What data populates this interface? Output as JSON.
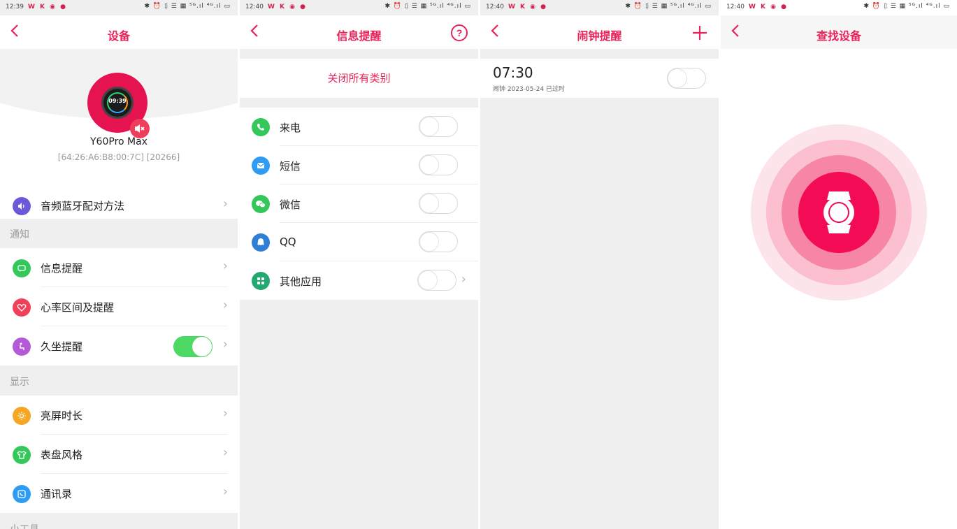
{
  "panels": {
    "device": {
      "status": {
        "time": "12:39",
        "apps": "W K ◉ ●",
        "sys": "✱ ⏰ ▯ ☰ ▦ ⁵ᴳ.ıl ⁴ᴳ.ıl ▭"
      },
      "title": "设备",
      "device_name": "Y60Pro Max",
      "device_meta": "[64:26:A6:B8:00:7C]   [20266]",
      "watch_time": "09:39",
      "rows_top": [
        {
          "label": "音频蓝牙配对方法",
          "icon": "speaker-icon",
          "color": "#6a5ad8"
        }
      ],
      "section_notify": "通知",
      "rows_notify": [
        {
          "label": "信息提醒",
          "icon": "message-icon",
          "color": "#34c759"
        },
        {
          "label": "心率区间及提醒",
          "icon": "heart-icon",
          "color": "#f0405a"
        },
        {
          "label": "久坐提醒",
          "icon": "sedentary-icon",
          "color": "#b45ad8",
          "toggle": true
        }
      ],
      "section_display": "显示",
      "rows_display": [
        {
          "label": "亮屏时长",
          "icon": "brightness-icon",
          "color": "#f5a623"
        },
        {
          "label": "表盘风格",
          "icon": "shirt-icon",
          "color": "#34c759"
        },
        {
          "label": "通讯录",
          "icon": "contacts-icon",
          "color": "#2e9cf5"
        }
      ],
      "section_tools": "小工具"
    },
    "messages": {
      "status": {
        "time": "12:40",
        "apps": "W K ◉ ●",
        "sys": "✱ ⏰ ▯ ☰ ▦ ⁵ᴳ.ıl ⁴ᴳ.ıl ▭"
      },
      "title": "信息提醒",
      "close_all": "关闭所有类别",
      "apps": [
        {
          "label": "来电",
          "icon": "phone-icon",
          "color": "#34c759"
        },
        {
          "label": "短信",
          "icon": "sms-icon",
          "color": "#2e9cf5"
        },
        {
          "label": "微信",
          "icon": "wechat-icon",
          "color": "#34c759"
        },
        {
          "label": "QQ",
          "icon": "qq-icon",
          "color": "#2e7fd6"
        },
        {
          "label": "其他应用",
          "icon": "apps-icon",
          "color": "#22a870"
        }
      ]
    },
    "alarm": {
      "status": {
        "time": "12:40",
        "apps": "W K ◉ ●",
        "sys": "✱ ⏰ ▯ ☰ ▦ ⁵ᴳ.ıl ⁴ᴳ.ıl ▭"
      },
      "title": "闹钟提醒",
      "time": "07:30",
      "meta": "闹钟   2023-05-24     已过时"
    },
    "find": {
      "status": {
        "time": "12:40",
        "apps": "W K ◉ ●",
        "sys": "✱ ⏰ ▯ ☰ ▦ ⁵ᴳ.ıl ⁴ᴳ.ıl ▭"
      },
      "title": "查找设备"
    }
  },
  "colors": {
    "accent": "#e8235a",
    "toggle_on": "#4cd964"
  },
  "sedentary_toggle_on": true
}
